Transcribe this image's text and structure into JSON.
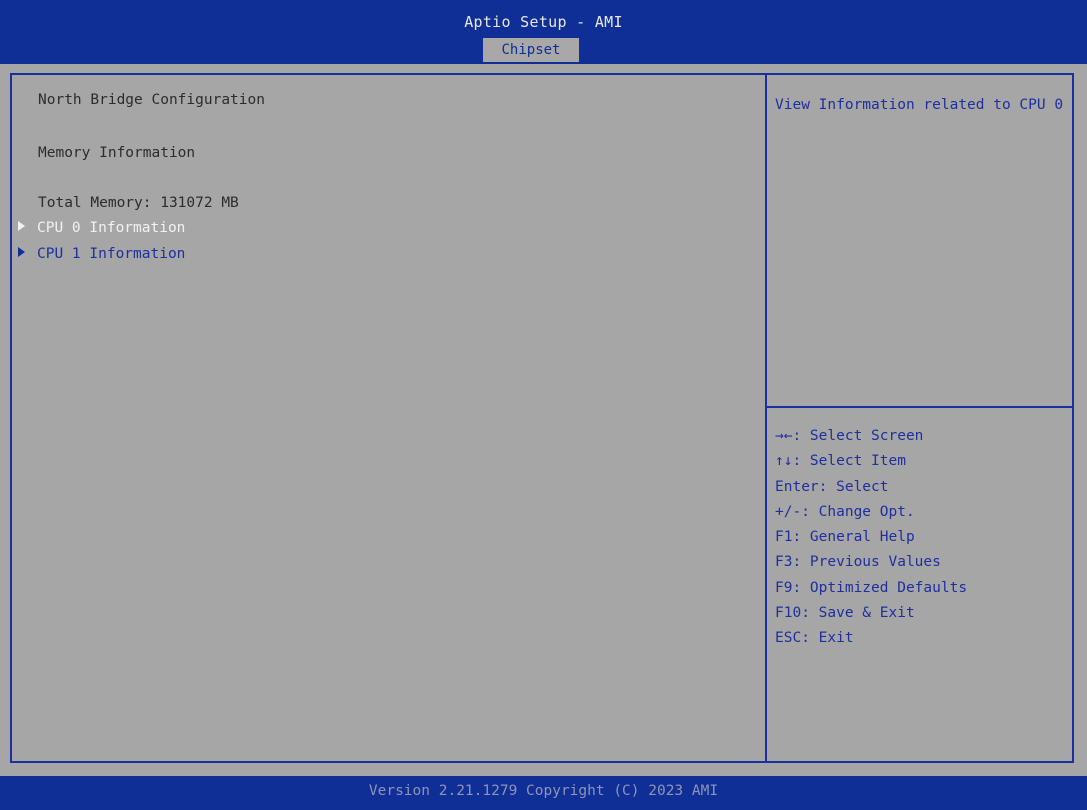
{
  "header": {
    "title": "Aptio Setup - AMI",
    "active_tab": "Chipset"
  },
  "main": {
    "heading": "North Bridge Configuration",
    "subheading": "Memory Information",
    "total_memory": "Total Memory: 131072 MB",
    "items": [
      {
        "label": "CPU 0 Information",
        "selected": true
      },
      {
        "label": "CPU 1 Information",
        "selected": false
      }
    ]
  },
  "help": {
    "description": "View Information related to CPU 0",
    "keys": [
      "→←: Select Screen",
      "↑↓: Select Item",
      "Enter: Select",
      "+/-: Change Opt.",
      "F1: General Help",
      "F3: Previous Values",
      "F9: Optimized Defaults",
      "F10: Save & Exit",
      "ESC: Exit"
    ]
  },
  "footer": {
    "version": "Version 2.21.1279 Copyright (C) 2023 AMI"
  },
  "colors": {
    "bar_blue": "#0f2e96",
    "panel_gray": "#a6a6a6",
    "text_blue": "#1e2f9e",
    "text_dark": "#2c2c2c",
    "selected_text": "#f2f2f2"
  }
}
